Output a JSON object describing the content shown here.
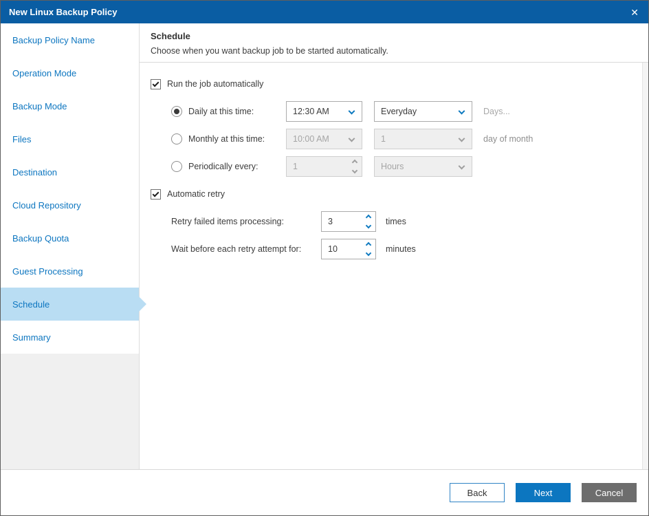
{
  "window": {
    "title": "New Linux Backup Policy",
    "close_glyph": "✕"
  },
  "sidebar": {
    "items": [
      {
        "label": "Backup Policy Name",
        "selected": false
      },
      {
        "label": "Operation Mode",
        "selected": false
      },
      {
        "label": "Backup Mode",
        "selected": false
      },
      {
        "label": "Files",
        "selected": false
      },
      {
        "label": "Destination",
        "selected": false
      },
      {
        "label": "Cloud Repository",
        "selected": false
      },
      {
        "label": "Backup Quota",
        "selected": false
      },
      {
        "label": "Guest Processing",
        "selected": false
      },
      {
        "label": "Schedule",
        "selected": true
      },
      {
        "label": "Summary",
        "selected": false
      }
    ]
  },
  "header": {
    "title": "Schedule",
    "subtitle": "Choose when you want backup job to be started automatically."
  },
  "schedule": {
    "run_automatically": {
      "label": "Run the job automatically",
      "checked": true
    },
    "daily": {
      "label": "Daily at this time:",
      "selected": true,
      "time": "12:30 AM",
      "frequency": "Everyday",
      "days_placeholder": "Days..."
    },
    "monthly": {
      "label": "Monthly at this time:",
      "selected": false,
      "time": "10:00 AM",
      "day": "1",
      "suffix": "day of month"
    },
    "periodically": {
      "label": "Periodically every:",
      "selected": false,
      "value": "1",
      "unit": "Hours"
    },
    "retry": {
      "label": "Automatic retry",
      "checked": true,
      "rows": [
        {
          "label": "Retry failed items processing:",
          "value": "3",
          "suffix": "times"
        },
        {
          "label": "Wait before each retry attempt for:",
          "value": "10",
          "suffix": "minutes"
        }
      ]
    }
  },
  "footer": {
    "back_label": "Back",
    "next_label": "Next",
    "cancel_label": "Cancel"
  },
  "colors": {
    "titlebar": "#0a5da3",
    "sidebar_link": "#0d76c0",
    "selected_item_bg": "#b9ddf3",
    "accent": "#0c76c0",
    "cancel_button_bg": "#6d6d6d"
  }
}
